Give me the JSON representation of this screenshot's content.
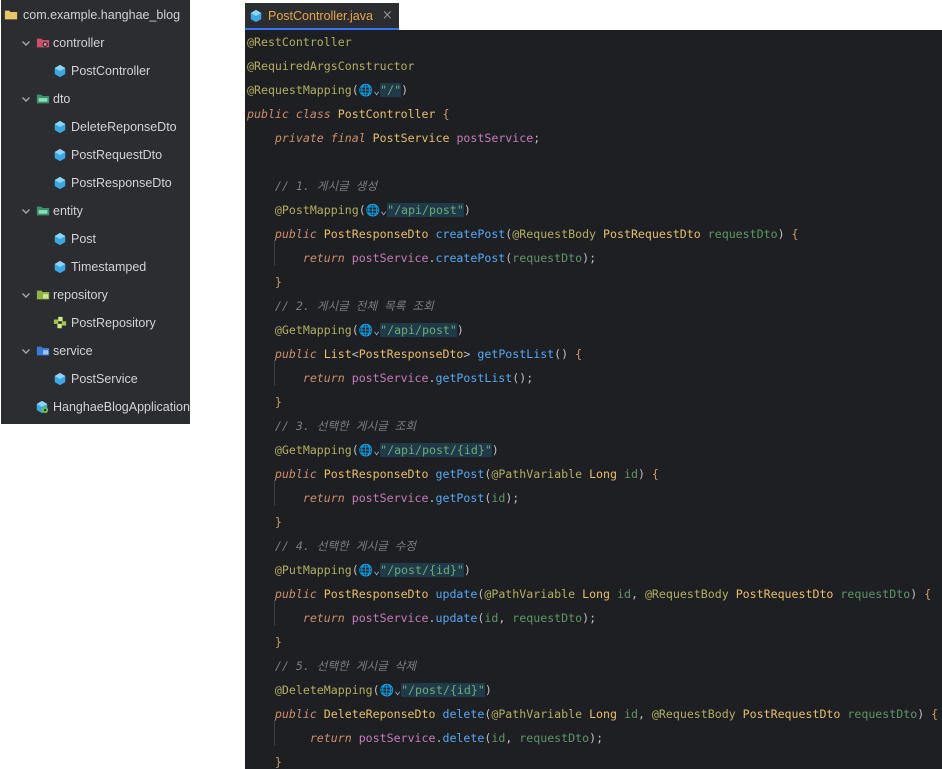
{
  "tree": {
    "root": {
      "label": "com.example.hanghae_blog",
      "icon": "folder-icon"
    },
    "packages": [
      {
        "label": "controller",
        "icon": "package-controller-icon",
        "children": [
          {
            "label": "PostController",
            "icon": "class-icon"
          }
        ]
      },
      {
        "label": "dto",
        "icon": "package-icon",
        "children": [
          {
            "label": "DeleteReponseDto",
            "icon": "class-icon"
          },
          {
            "label": "PostRequestDto",
            "icon": "class-icon"
          },
          {
            "label": "PostResponseDto",
            "icon": "class-icon"
          }
        ]
      },
      {
        "label": "entity",
        "icon": "package-icon",
        "children": [
          {
            "label": "Post",
            "icon": "class-icon"
          },
          {
            "label": "Timestamped",
            "icon": "class-icon"
          }
        ]
      },
      {
        "label": "repository",
        "icon": "package-repository-icon",
        "children": [
          {
            "label": "PostRepository",
            "icon": "interface-icon"
          }
        ]
      },
      {
        "label": "service",
        "icon": "package-service-icon",
        "children": [
          {
            "label": "PostService",
            "icon": "class-icon"
          }
        ]
      }
    ],
    "app": {
      "label": "HanghaeBlogApplication",
      "icon": "spring-app-icon"
    }
  },
  "editor": {
    "tab": {
      "label": "PostController.java",
      "close": "×",
      "icon": "java-class-icon"
    },
    "lines": [
      "@RestController",
      "@RequiredArgsConstructor",
      "@RequestMapping(🌐⌄\"/\")",
      "public class PostController {",
      "    private final PostService postService;",
      "",
      "    // 1. 게시글 생성",
      "    @PostMapping(🌐⌄\"/api/post\")",
      "    public PostResponseDto createPost(@RequestBody PostRequestDto requestDto) {",
      "        return postService.createPost(requestDto);",
      "    }",
      "    // 2. 게시글 전체 목록 조회",
      "    @GetMapping(🌐⌄\"/api/post\")",
      "    public List<PostResponseDto> getPostList() {",
      "        return postService.getPostList();",
      "    }",
      "    // 3. 선택한 게시글 조회",
      "    @GetMapping(🌐⌄\"/api/post/{id}\")",
      "    public PostResponseDto getPost(@PathVariable Long id) {",
      "        return postService.getPost(id);",
      "    }",
      "    // 4. 선택한 게시글 수정",
      "    @PutMapping(🌐⌄\"/post/{id}\")",
      "    public PostResponseDto update(@PathVariable Long id, @RequestBody PostRequestDto requestDto) {",
      "        return postService.update(id, requestDto);",
      "    }",
      "    // 5. 선택한 게시글 삭제",
      "    @DeleteMapping(🌐⌄\"/post/{id}\")",
      "    public DeleteReponseDto delete(@PathVariable Long id, @RequestBody PostRequestDto requestDto) {",
      "         return postService.delete(id, requestDto);",
      "    }"
    ]
  },
  "colors": {
    "tree_bg": "#2b2d30",
    "editor_bg": "#1e1f22",
    "tab_label": "#e8a648",
    "tab_underline": "#3574f0",
    "annotation": "#b3ae60",
    "keyword": "#cf8e6d",
    "class_name": "#e8bf6a",
    "method": "#56a8f5",
    "string": "#6aab73",
    "field": "#c77dbb",
    "comment": "#7a7e85"
  }
}
